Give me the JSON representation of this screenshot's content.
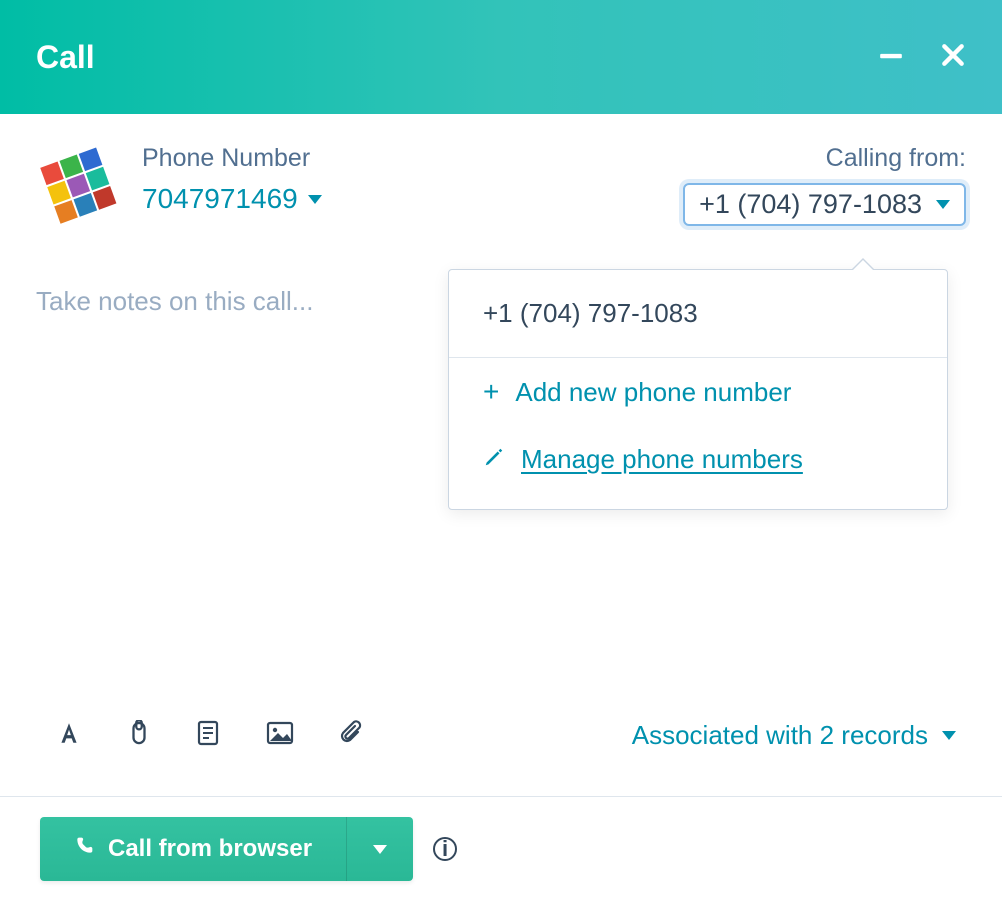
{
  "header": {
    "title": "Call"
  },
  "contact": {
    "phone_label": "Phone Number",
    "phone_number": "7047971469"
  },
  "calling_from": {
    "label": "Calling from:",
    "selected": "+1 (704) 797-1083"
  },
  "popover": {
    "options": [
      "+1 (704) 797-1083"
    ],
    "add_label": "Add new phone number",
    "manage_label": "Manage phone numbers"
  },
  "notes": {
    "placeholder": "Take notes on this call..."
  },
  "associated": {
    "label": "Associated with 2 records"
  },
  "footer": {
    "call_button": "Call from browser"
  }
}
